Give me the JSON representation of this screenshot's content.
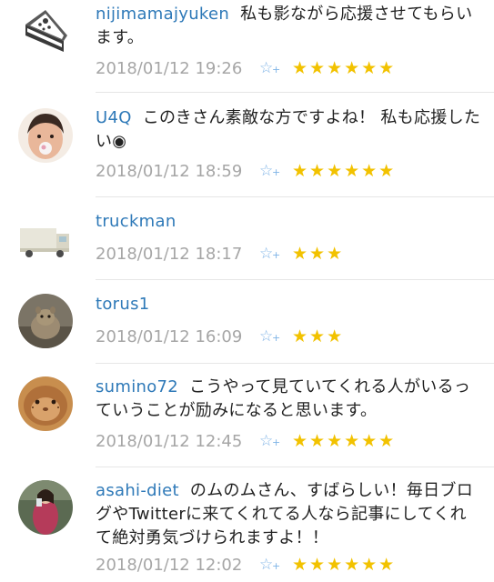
{
  "comments": [
    {
      "username": "nijimamajyuken",
      "text": "私も影ながら応援させてもらいます。",
      "timestamp": "2018/01/12 19:26",
      "stars": "★★★★★★",
      "star_count": 6,
      "avatar": "cake-slice-icon"
    },
    {
      "username": "U4Q",
      "text": "このきさん素敵な方ですよね！ 私も応援したい◉",
      "timestamp": "2018/01/12 18:59",
      "stars": "★★★★★★",
      "star_count": 6,
      "avatar": "person-photo"
    },
    {
      "username": "truckman",
      "text": "",
      "timestamp": "2018/01/12 18:17",
      "stars": "★★★",
      "star_count": 3,
      "avatar": "truck-icon"
    },
    {
      "username": "torus1",
      "text": "",
      "timestamp": "2018/01/12 16:09",
      "stars": "★★★",
      "star_count": 3,
      "avatar": "animal-photo"
    },
    {
      "username": "sumino72",
      "text": "こうやって見ていてくれる人がいるっていうことが励みになると思います。",
      "timestamp": "2018/01/12 12:45",
      "stars": "★★★★★★",
      "star_count": 6,
      "avatar": "hamster-photo"
    },
    {
      "username": "asahi-diet",
      "text": "のムのムさん、すばらしい！毎日ブログやTwitterに来てくれてる人なら記事にしてくれて絶対勇気づけられますよ！！",
      "timestamp": "2018/01/12 12:02",
      "stars": "★★★★★★",
      "star_count": 6,
      "avatar": "person-photo"
    }
  ],
  "add_star_glyph": "☆",
  "add_star_plus": "+",
  "colors": {
    "username": "#2e79b8",
    "timestamp": "#a6a6a6",
    "star": "#f2c200",
    "add_star": "#7fb3e6"
  }
}
